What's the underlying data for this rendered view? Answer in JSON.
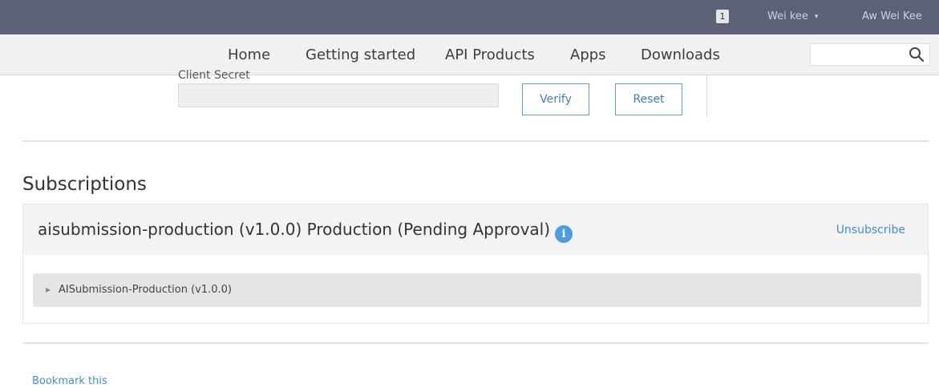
{
  "topbar": {
    "notification_count": "1",
    "user_menu_label": "Wei kee",
    "user_menu_caret": "▾",
    "user_name": "Aw Wei Kee"
  },
  "nav": {
    "items": [
      "Home",
      "Getting started",
      "API Products",
      "Apps",
      "Downloads"
    ],
    "search_placeholder": ""
  },
  "credentials": {
    "client_secret_label": "Client Secret",
    "client_secret_value": "",
    "verify_label": "Verify",
    "reset_label": "Reset"
  },
  "subscriptions": {
    "title": "Subscriptions",
    "items": [
      {
        "title": "aisubmission-production (v1.0.0) Production (Pending Approval)",
        "info_icon": "info-icon",
        "unsubscribe_label": "Unsubscribe",
        "api_name": "AISubmission-Production (v1.0.0)"
      }
    ]
  },
  "footer": {
    "bookmark_label": "Bookmark this"
  },
  "colors": {
    "topbar_bg": "#5b6176",
    "link": "#3f8fd0",
    "button_border": "#5ca3d8",
    "info_icon": "#4a9be0"
  }
}
